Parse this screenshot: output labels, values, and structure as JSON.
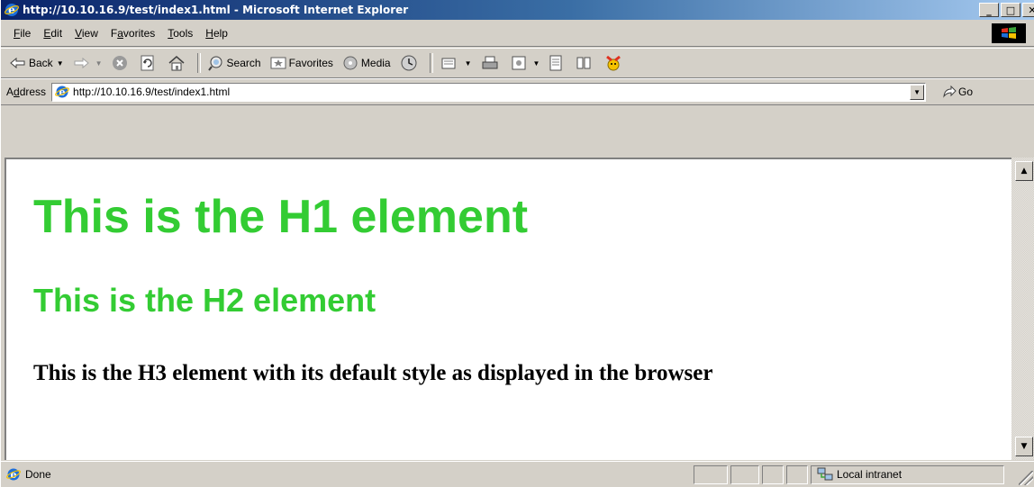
{
  "window": {
    "title": "http://10.10.16.9/test/index1.html - Microsoft Internet Explorer",
    "minimize_glyph": "_",
    "maximize_glyph": "□",
    "close_glyph": "✕"
  },
  "menu": {
    "items": [
      {
        "accel": "F",
        "rest": "ile"
      },
      {
        "accel": "E",
        "rest": "dit"
      },
      {
        "accel": "V",
        "rest": "iew"
      },
      {
        "pre": "F",
        "accel": "a",
        "rest": "vorites"
      },
      {
        "accel": "T",
        "rest": "ools"
      },
      {
        "accel": "H",
        "rest": "elp"
      }
    ]
  },
  "toolbar": {
    "back_label": "Back",
    "search_label": "Search",
    "favorites_label": "Favorites",
    "media_label": "Media"
  },
  "address": {
    "label_pre": "A",
    "label_accel": "d",
    "label_rest": "dress",
    "url": "http://10.10.16.9/test/index1.html",
    "go_label": "Go"
  },
  "content": {
    "h1": "This is the H1 element",
    "h2": "This is the H2 element",
    "h3": "This is the H3 element with its default style as displayed in the browser",
    "heading_color": "#33cc33"
  },
  "status": {
    "text": "Done",
    "zone": "Local intranet"
  }
}
